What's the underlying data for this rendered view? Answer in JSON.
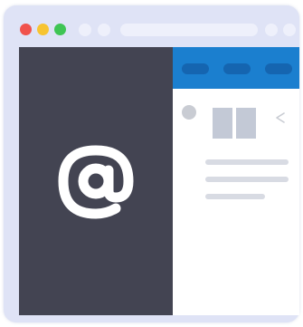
{
  "window": {
    "traffic_lights": [
      {
        "name": "close",
        "color": "#f0524c"
      },
      {
        "name": "minimize",
        "color": "#f7c431"
      },
      {
        "name": "maximize",
        "color": "#3fc554"
      }
    ],
    "title_controls_color": "#eef0fb"
  },
  "left_pane": {
    "icon": "at-sign-icon",
    "icon_color": "#ffffff",
    "background": "#434452"
  },
  "right_pane": {
    "header_color": "#1b7fcf",
    "header_pill_color": "#1565b0",
    "header_pills": [
      "pill",
      "pill",
      "pill"
    ],
    "placeholder_color": "#c3c9d6",
    "text_line_color": "#d8dbe3"
  }
}
